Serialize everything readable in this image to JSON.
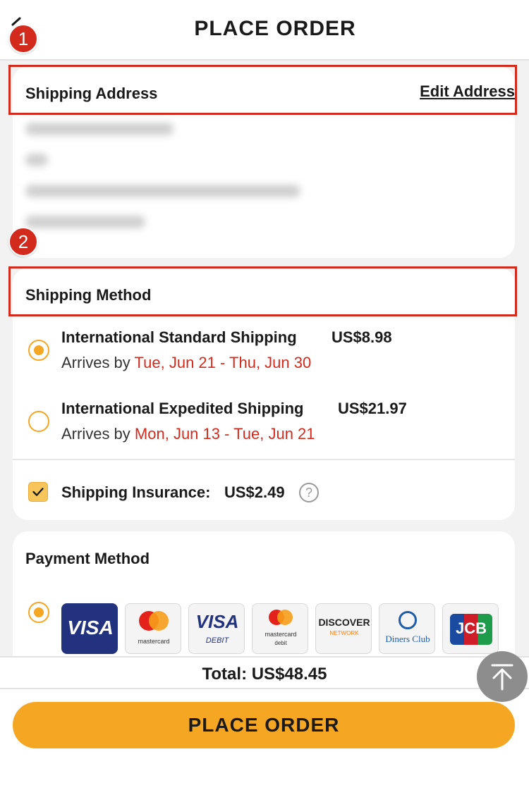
{
  "header": {
    "title": "PLACE ORDER",
    "back_icon": "chevron-left-icon"
  },
  "steps": [
    "1",
    "2"
  ],
  "shipping_address": {
    "title": "Shipping Address",
    "edit_label": "Edit Address"
  },
  "shipping_method": {
    "title": "Shipping Method",
    "options": [
      {
        "name": "International Standard Shipping",
        "price": "US$8.98",
        "arrives_prefix": "Arrives by ",
        "dates": "Tue, Jun 21 - Thu, Jun 30",
        "selected": true
      },
      {
        "name": "International Expedited Shipping",
        "price": "US$21.97",
        "arrives_prefix": "Arrives by ",
        "dates": "Mon, Jun 13 - Tue, Jun 21",
        "selected": false
      }
    ],
    "insurance": {
      "label": "Shipping Insurance:",
      "price": "US$2.49",
      "checked": true,
      "help_icon": "question-icon"
    }
  },
  "payment_method": {
    "title": "Payment Method",
    "cards": [
      {
        "name": "visa",
        "text": "VISA"
      },
      {
        "name": "mastercard",
        "text": "mastercard"
      },
      {
        "name": "visa-debit",
        "text": "VISA",
        "sub": "DEBIT"
      },
      {
        "name": "mastercard-debit",
        "text": "mastercard",
        "sub": "debit"
      },
      {
        "name": "discover",
        "text": "DISCOVER",
        "sub": "NETWORK"
      },
      {
        "name": "diners-club",
        "text": "Diners Club"
      },
      {
        "name": "jcb",
        "text": "JCB"
      }
    ]
  },
  "footer": {
    "total": "Total: US$48.45",
    "place_order": "PLACE ORDER",
    "scroll_top_icon": "arrow-up-icon"
  },
  "colors": {
    "accent": "#f5a623",
    "highlight": "#d32a1e",
    "date": "#d32a1e"
  }
}
